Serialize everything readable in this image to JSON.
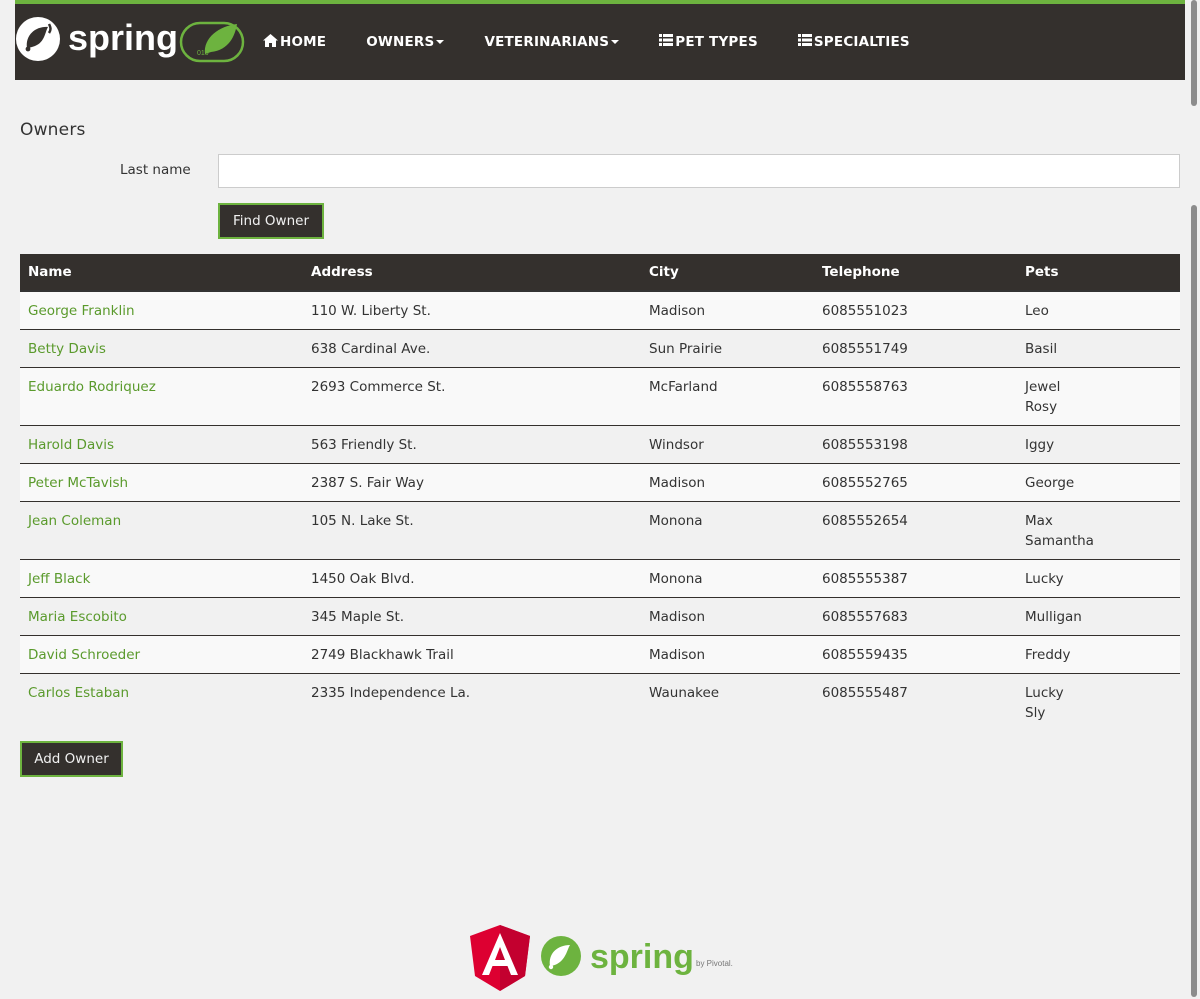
{
  "nav": {
    "brand_alt": "spring",
    "items": [
      {
        "label": "HOME",
        "icon": "home-icon",
        "dropdown": false
      },
      {
        "label": "OWNERS",
        "icon": "",
        "dropdown": true
      },
      {
        "label": "VETERINARIANS",
        "icon": "",
        "dropdown": true
      },
      {
        "label": "PET TYPES",
        "icon": "list-icon",
        "dropdown": false
      },
      {
        "label": "SPECIALTIES",
        "icon": "list-icon",
        "dropdown": false
      }
    ]
  },
  "page": {
    "title": "Owners",
    "search_label": "Last name",
    "search_value": "",
    "find_button": "Find Owner",
    "add_button": "Add Owner"
  },
  "table": {
    "headers": [
      "Name",
      "Address",
      "City",
      "Telephone",
      "Pets"
    ],
    "rows": [
      {
        "name": "George Franklin",
        "address": "110 W. Liberty St.",
        "city": "Madison",
        "telephone": "6085551023",
        "pets": [
          "Leo"
        ]
      },
      {
        "name": "Betty Davis",
        "address": "638 Cardinal Ave.",
        "city": "Sun Prairie",
        "telephone": "6085551749",
        "pets": [
          "Basil"
        ]
      },
      {
        "name": "Eduardo Rodriquez",
        "address": "2693 Commerce St.",
        "city": "McFarland",
        "telephone": "6085558763",
        "pets": [
          "Jewel",
          "Rosy"
        ]
      },
      {
        "name": "Harold Davis",
        "address": "563 Friendly St.",
        "city": "Windsor",
        "telephone": "6085553198",
        "pets": [
          "Iggy"
        ]
      },
      {
        "name": "Peter McTavish",
        "address": "2387 S. Fair Way",
        "city": "Madison",
        "telephone": "6085552765",
        "pets": [
          "George"
        ]
      },
      {
        "name": "Jean Coleman",
        "address": "105 N. Lake St.",
        "city": "Monona",
        "telephone": "6085552654",
        "pets": [
          "Max",
          "Samantha"
        ]
      },
      {
        "name": "Jeff Black",
        "address": "1450 Oak Blvd.",
        "city": "Monona",
        "telephone": "6085555387",
        "pets": [
          "Lucky"
        ]
      },
      {
        "name": "Maria Escobito",
        "address": "345 Maple St.",
        "city": "Madison",
        "telephone": "6085557683",
        "pets": [
          "Mulligan"
        ]
      },
      {
        "name": "David Schroeder",
        "address": "2749 Blackhawk Trail",
        "city": "Madison",
        "telephone": "6085559435",
        "pets": [
          "Freddy"
        ]
      },
      {
        "name": "Carlos Estaban",
        "address": "2335 Independence La.",
        "city": "Waunakee",
        "telephone": "6085555487",
        "pets": [
          "Lucky",
          "Sly"
        ]
      }
    ]
  },
  "footer": {
    "logos": [
      "angular-logo",
      "spring-logo"
    ],
    "spring_text": "spring",
    "pivotal_text": "by Pivotal."
  },
  "colors": {
    "nav_bg": "#34302d",
    "accent": "#6db33f",
    "link": "#5a9a2c",
    "page_bg": "#f1f1f1",
    "angular_red": "#dd0031"
  }
}
